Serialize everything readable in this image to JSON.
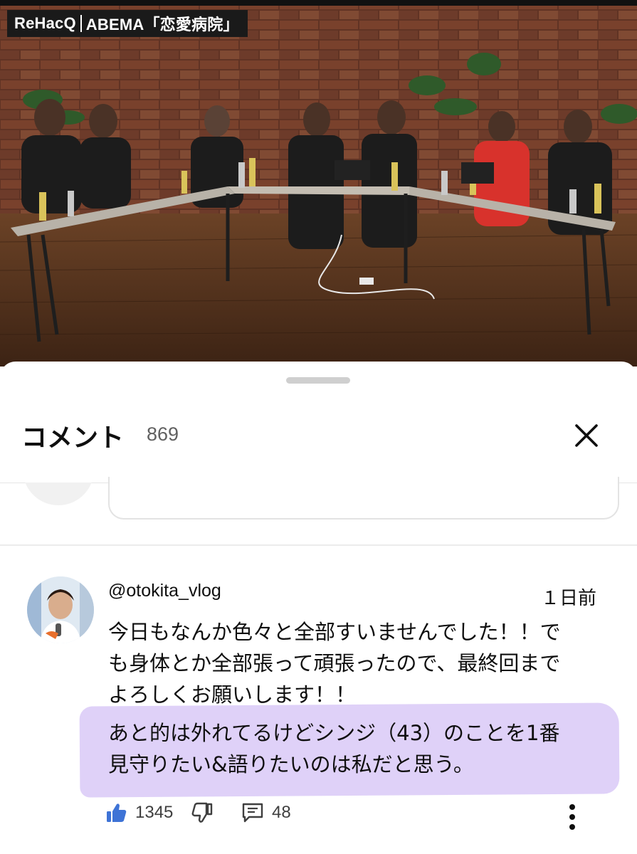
{
  "video": {
    "channel_badge": {
      "brand": "ReHacQ",
      "program": "ABEMA「恋愛病院」"
    }
  },
  "comments_sheet": {
    "title": "コメント",
    "count": "869",
    "close_icon": "close-icon",
    "comment": {
      "author": "@otokita_vlog",
      "time": "１日前",
      "text_line1": "今日もなんか色々と全部すいませんでした！！で",
      "text_line2": "も身体とか全部張って頑張ったので、最終回まで",
      "text_line3": "よろしくお願いします！！",
      "text_line4": "あと的は外れてるけどシンジ（43）のことを1番",
      "text_line5": "見守りたい&語りたいのは私だと思う。",
      "likes": "1345",
      "replies": "48",
      "highlight_color": "#d9c9f7"
    }
  },
  "colors": {
    "text_primary": "#0f0f0f",
    "text_secondary": "#606060",
    "like_blue": "#3e73d6"
  }
}
